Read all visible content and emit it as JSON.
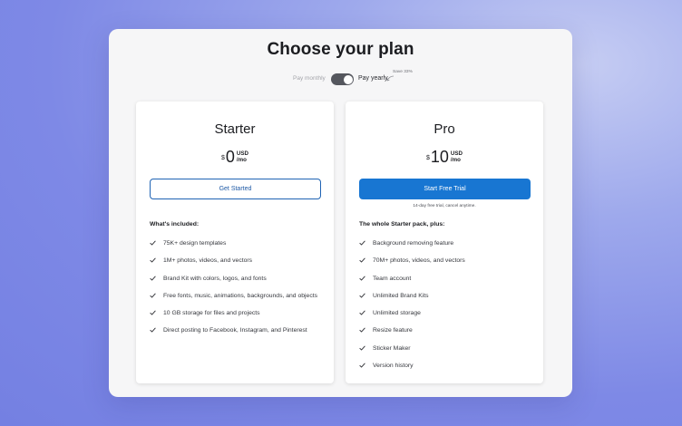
{
  "header": {
    "title": "Choose your plan"
  },
  "billing": {
    "monthly_label": "Pay monthly",
    "yearly_label": "Pay yearly",
    "save_badge": "Save 33%",
    "toggle_state": "yearly"
  },
  "plans": [
    {
      "name": "Starter",
      "currency": "$",
      "amount": "0",
      "unit_top": "USD",
      "unit_bottom": "/mo",
      "cta_label": "Get Started",
      "note": "",
      "included_heading": "What's included:",
      "features": [
        "75K+ design templates",
        "1M+ photos, videos, and vectors",
        "Brand Kit with colors, logos, and fonts",
        "Free fonts, music, animations, backgrounds, and objects",
        "10 GB storage for files and projects",
        "Direct posting to Facebook, Instagram, and Pinterest"
      ]
    },
    {
      "name": "Pro",
      "currency": "$",
      "amount": "10",
      "unit_top": "USD",
      "unit_bottom": "/mo",
      "cta_label": "Start Free Trial",
      "note": "14-day free trial, cancel anytime.",
      "included_heading": "The whole Starter pack, plus:",
      "features": [
        "Background removing feature",
        "70M+ photos, videos, and vectors",
        "Team account",
        "Unlimited Brand Kits",
        "Unlimited storage",
        "Resize feature",
        "Sticker Maker",
        "Version history"
      ]
    }
  ],
  "colors": {
    "accent": "#1876d2",
    "outline_button": "#1f63b4",
    "toggle_track": "#55575e",
    "modal_bg": "#f6f6f7"
  },
  "icons": [
    "check-icon",
    "curved-arrow-icon"
  ]
}
